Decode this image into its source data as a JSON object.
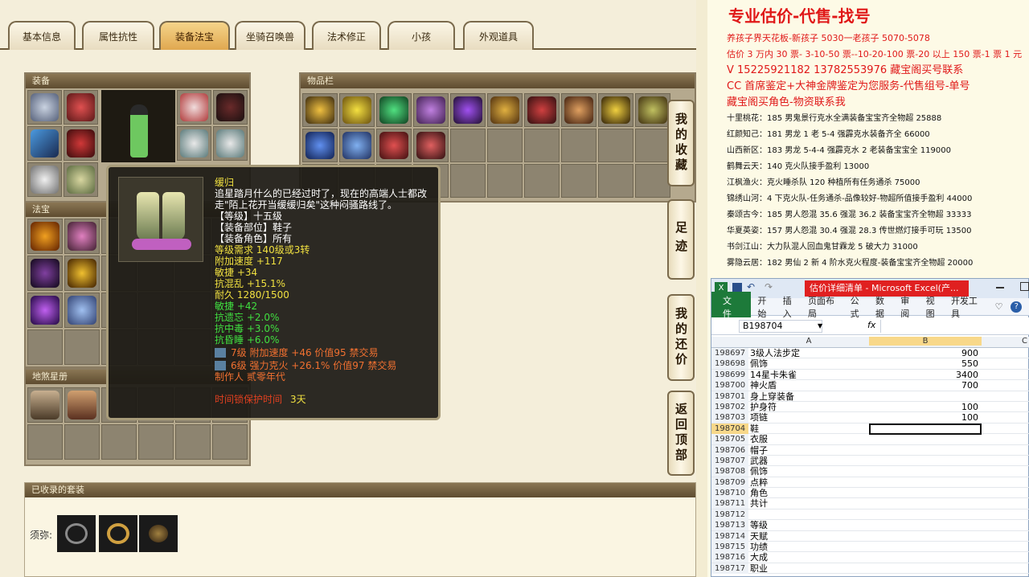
{
  "game": {
    "tabs": [
      "基本信息",
      "属性抗性",
      "装备法宝",
      "坐骑召唤兽",
      "法术修正",
      "小孩",
      "外观道具"
    ],
    "active_tab": "装备法宝",
    "equip_title": "装备",
    "inv_title": "物品栏",
    "fabao_title": "法宝",
    "disha_title": "地煞星册",
    "collected_title": "已收录的套装",
    "collected_label": "须弥:",
    "side_buttons": {
      "receive": "我的收藏",
      "footprint": "足迹",
      "counter": "我的还价",
      "back_top": "返回顶部"
    },
    "tooltip": {
      "name": "缓归",
      "desc_lines": [
        "追星踏月什么的已经过时了，现在的高端人士都改",
        "走\"陌上花开当缓缓归矣\"这种闷骚路线了。"
      ],
      "level": "【等级】十五级",
      "slot": "【装备部位】鞋子",
      "role": "【装备角色】所有",
      "req": "等级需求 140级或3转",
      "stats_white": [
        "附加速度 +117",
        "敏捷 +34",
        "抗混乱 +15.1%",
        "耐久 1280/1500"
      ],
      "stats_green": [
        "敏捷 +42",
        "抗遗忘 +2.0%",
        "抗中毒 +3.0%",
        "抗昏睡 +6.0%"
      ],
      "gems": [
        "7级 附加速度 +46 价值95 禁交易",
        "6级 强力克火 +26.1% 价值97 禁交易"
      ],
      "maker": "制作人 贰零年代",
      "protect_label": "时间锁保护时间",
      "protect_value": "3天"
    }
  },
  "ad": {
    "title": "专业估价-代售-找号",
    "red_lines": [
      "养孩子界天花板-新孩子 5030一老孩子 5070-5078",
      "估价 3 万内 30 票- 3-10-50 票--10-20-100 票-20 以上 150 票-1 票 1 元",
      "V 15225921182      13782553976    藏宝阁买号联系",
      "CC 首席鉴定+大神金牌鉴定为您服务-代售组号-单号",
      "藏宝阁买角色-物资联系我"
    ],
    "listings": [
      "十里桃花：185 男鬼景行克水全满装备宝宝齐全物超 25888",
      "红颜知己：181 男龙 1 老 5-4 强霹克水装备齐全 66000",
      "山西新区：183 男龙 5-4-4 强霹克水 2 老装备宝宝全 119000",
      "鹤舞云天：140 克火队接手盈利 13000",
      "江枫渔火：克火睡杀队 120 种植所有任务通杀 75000",
      "锦绣山河：4 下克火队-任务通杀-品像较好-物超所值接手盈利 44000",
      "秦颂古今：185 男人怨混 35.6 强混 36.2 装备宝宝齐全物超 33333",
      "华夏英姿：157 男人怨混 30.4 强混 28.3 传世燃灯接手可玩 13500",
      "书剑江山：大力队混人回血鬼甘霖龙 5 破大力 31000",
      "雾隐云居：182 男仙 2 新 4 阶水克火程度-装备宝宝齐全物超 20000"
    ]
  },
  "excel": {
    "title": "估价详细清单 - Microsoft Excel(产...",
    "menu": [
      "开始",
      "插入",
      "页面布局",
      "公式",
      "数据",
      "审阅",
      "视图",
      "开发工具"
    ],
    "file_tab": "文件",
    "name_box": "B198704",
    "fx": "fx",
    "col_a": "A",
    "col_b": "B",
    "col_c": "C",
    "rows": [
      {
        "n": "198697",
        "a": "3级人法步定",
        "b": "900"
      },
      {
        "n": "198698",
        "a": "佩饰",
        "b": "550"
      },
      {
        "n": "198699",
        "a": "14星卡朱雀",
        "b": "3400"
      },
      {
        "n": "198700",
        "a": "神火盾",
        "b": "700"
      },
      {
        "n": "198701",
        "a": "身上穿装备",
        "b": ""
      },
      {
        "n": "198702",
        "a": "护身符",
        "b": "100"
      },
      {
        "n": "198703",
        "a": "项链",
        "b": "100"
      },
      {
        "n": "198704",
        "a": "鞋",
        "b": ""
      },
      {
        "n": "198705",
        "a": "衣服",
        "b": ""
      },
      {
        "n": "198706",
        "a": "帽子",
        "b": ""
      },
      {
        "n": "198707",
        "a": "武器",
        "b": ""
      },
      {
        "n": "198708",
        "a": "佩饰",
        "b": ""
      },
      {
        "n": "198709",
        "a": "点粹",
        "b": ""
      },
      {
        "n": "198710",
        "a": "角色",
        "b": ""
      },
      {
        "n": "198711",
        "a": "共计",
        "b": ""
      },
      {
        "n": "198712",
        "a": "",
        "b": ""
      },
      {
        "n": "198713",
        "a": "等级",
        "b": ""
      },
      {
        "n": "198714",
        "a": "天赋",
        "b": ""
      },
      {
        "n": "198715",
        "a": "功绩",
        "b": ""
      },
      {
        "n": "198716",
        "a": "大成",
        "b": ""
      },
      {
        "n": "198717",
        "a": "职业",
        "b": ""
      }
    ]
  }
}
